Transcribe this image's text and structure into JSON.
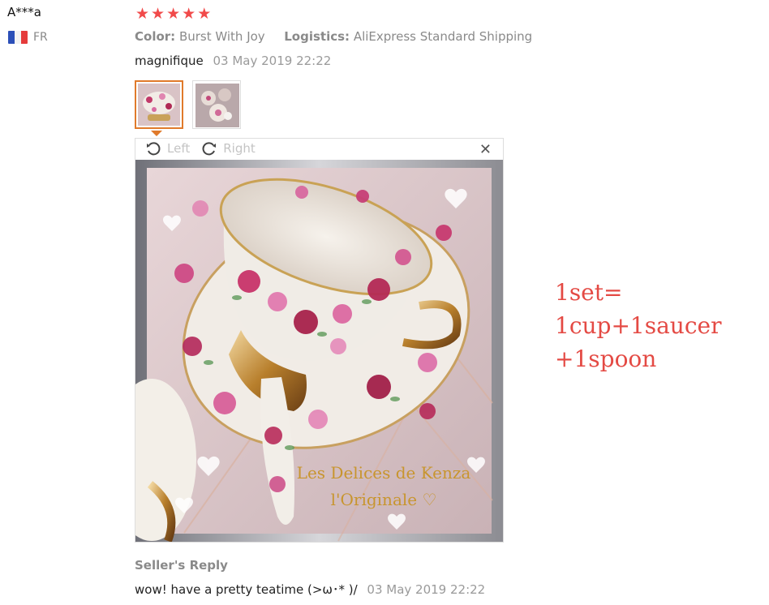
{
  "reviewer": {
    "name": "A***a",
    "country": "FR"
  },
  "rating": {
    "stars": 5,
    "max": 5,
    "color": "#f14a4a"
  },
  "attributes": {
    "color_label": "Color:",
    "color_value": "Burst With Joy",
    "logistics_label": "Logistics:",
    "logistics_value": "AliExpress Standard Shipping"
  },
  "review": {
    "text": "magnifique",
    "date": "03 May 2019 22:22"
  },
  "thumbnails": {
    "selected_index": 0,
    "count": 2
  },
  "viewer": {
    "rotate_left": "Left",
    "rotate_right": "Right",
    "watermark_line1": "Les Delices de Kenza",
    "watermark_line2": "l'Originale ♡"
  },
  "side_note": {
    "line1": "1set=",
    "line2": "1cup+1saucer",
    "line3": "+1spoon"
  },
  "seller_reply": {
    "title": "Seller's Reply",
    "text": "wow! have a pretty teatime (>ω･* )/",
    "date": "03 May 2019 22:22"
  }
}
